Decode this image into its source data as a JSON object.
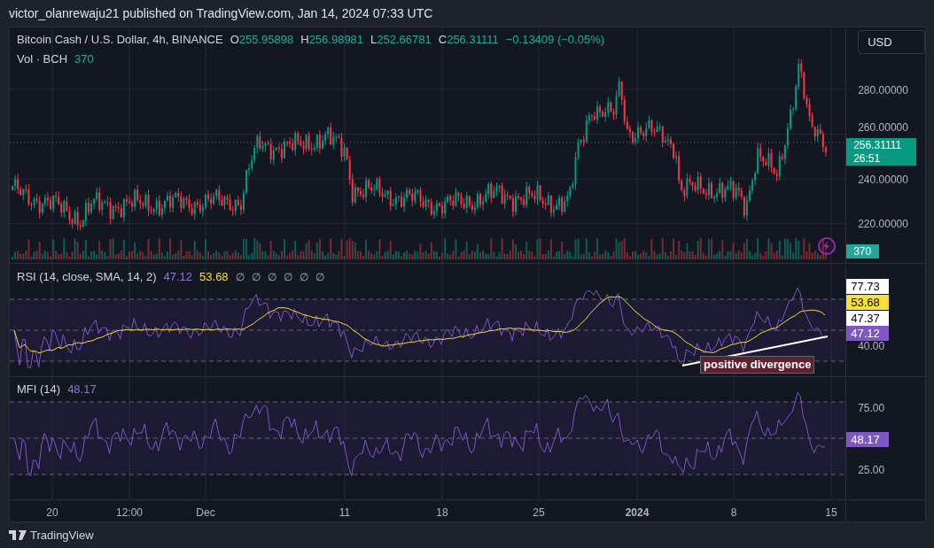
{
  "header": {
    "text": "victor_olanrewaju21 published on TradingView.com, Jan 14, 2024 07:33 UTC"
  },
  "legend": {
    "symbol": "Bitcoin Cash / U.S. Dollar, 4h, BINANCE",
    "ohlc": [
      {
        "key": "O",
        "value": "255.95898"
      },
      {
        "key": "H",
        "value": "256.98981"
      },
      {
        "key": "L",
        "value": "252.66781"
      },
      {
        "key": "C",
        "value": "256.31111"
      }
    ],
    "change": "−0.13409 (−0.05%)"
  },
  "volume_legend": {
    "label": "Vol · BCH",
    "value": "370"
  },
  "currency_button": "USD",
  "price_axis": [
    "280.00000",
    "260.00000",
    "240.00000",
    "220.00000"
  ],
  "last_price": {
    "price": "256.31111",
    "countdown": "26:51"
  },
  "volume_tag": "370",
  "rsi": {
    "title": "RSI (14, close, SMA, 14, 2)",
    "value": "47.12",
    "sma": "53.68",
    "extra": [
      "∅",
      "∅",
      "∅",
      "∅",
      "∅",
      "∅"
    ],
    "axis_tags": [
      {
        "text": "77.73",
        "color": "#ffffff"
      },
      {
        "text": "53.68",
        "color": "#f7e03a"
      },
      {
        "text": "47.37",
        "color": "#ffffff"
      },
      {
        "text": "47.12",
        "color": "#7e57c2"
      }
    ],
    "axis_label": "40.00",
    "annotation": "positive divergence"
  },
  "mfi": {
    "title": "MFI (14)",
    "value": "48.17",
    "axis": [
      "75.00",
      "25.00"
    ],
    "tag": "48.17"
  },
  "time_axis": [
    {
      "label": "20",
      "bold": false
    },
    {
      "label": "12:00",
      "bold": false
    },
    {
      "label": "Dec",
      "bold": false
    },
    {
      "label": "11",
      "bold": false
    },
    {
      "label": "18",
      "bold": false
    },
    {
      "label": "25",
      "bold": false
    },
    {
      "label": "2024",
      "bold": true
    },
    {
      "label": "8",
      "bold": false
    },
    {
      "label": "15",
      "bold": false
    }
  ],
  "footer": {
    "brand": "TradingView"
  }
}
